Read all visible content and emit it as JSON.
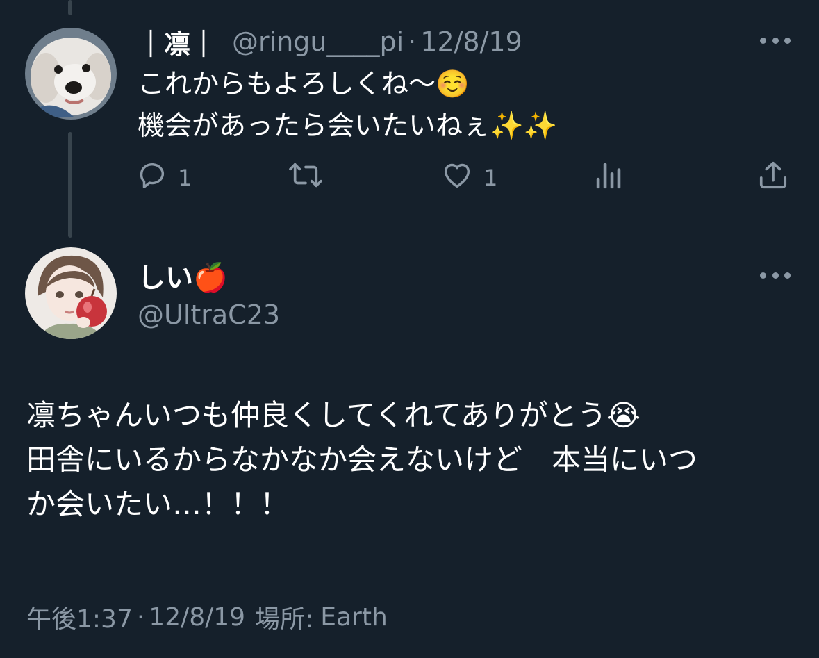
{
  "reply": {
    "name": "｜凛｜",
    "handle": "@ringu____pi",
    "separator": "·",
    "date": "12/8/19",
    "lines": [
      "これからもよろしくね〜☺️",
      "機会があったら会いたいねぇ✨✨"
    ],
    "actions": {
      "reply_count": "1",
      "retweet_count": "",
      "like_count": "1"
    }
  },
  "main": {
    "name": "しい🍎",
    "handle": "@UltraC23",
    "lines": [
      "凛ちゃんいつも仲良くしてくれてありがとう😭",
      "田舎にいるからなかなか会えないけど　本当にいつ",
      "か会いたい…！！！"
    ],
    "time": "午後1:37",
    "separator": "·",
    "date": "12/8/19",
    "place_label": "場所:",
    "place": "Earth"
  },
  "colors": {
    "background": "#15202b",
    "muted": "#8b98a5",
    "thread_line": "#38444d",
    "text": "#ffffff"
  },
  "icons": {
    "more": "more-horizontal-icon",
    "reply": "reply-icon",
    "retweet": "retweet-icon",
    "like": "heart-icon",
    "analytics": "analytics-icon",
    "share": "share-icon"
  }
}
